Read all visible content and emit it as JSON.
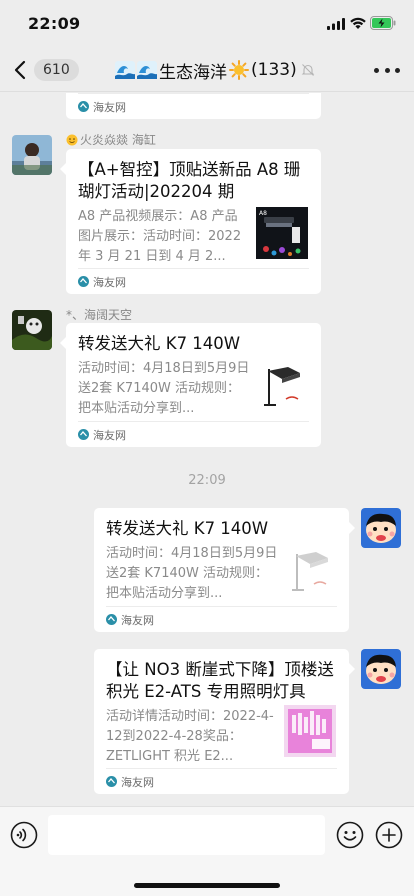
{
  "status_bar": {
    "time": "22:09"
  },
  "nav": {
    "unread_count": "610",
    "title": "生态海洋",
    "member_count": "(133)"
  },
  "messages": [
    {
      "source": "海友网"
    },
    {
      "sender": "火炎焱燚 海缸",
      "title": "【A+智控】顶贴送新品 A8 珊瑚灯活动|202204 期",
      "description": "A8 产品视频展示：A8 产品图片展示：活动时间：2022 年 3 月 21 日到 4 月 2...",
      "source": "海友网",
      "thumb_label": "A8"
    },
    {
      "sender": "*、海阔天空",
      "title": "转发送大礼 K7 140W",
      "description": "活动时间：4月18日到5月9日送2套 K7140W 活动规则：把本贴活动分享到...",
      "source": "海友网"
    },
    {
      "timestamp": "22:09"
    },
    {
      "title": "转发送大礼 K7 140W",
      "description": "活动时间：4月18日到5月9日送2套 K7140W 活动规则：把本贴活动分享到...",
      "source": "海友网"
    },
    {
      "title": "【让 NO3 断崖式下降】顶楼送积光 E2-ATS 专用照明灯具",
      "description": "活动详情活动时间：2022-4-12到2022-4-28奖品：ZETLIGHT 积光 E2...",
      "source": "海友网"
    }
  ],
  "colors": {
    "background": "#ededed",
    "card": "#ffffff",
    "accent_green": "#1aad19"
  }
}
